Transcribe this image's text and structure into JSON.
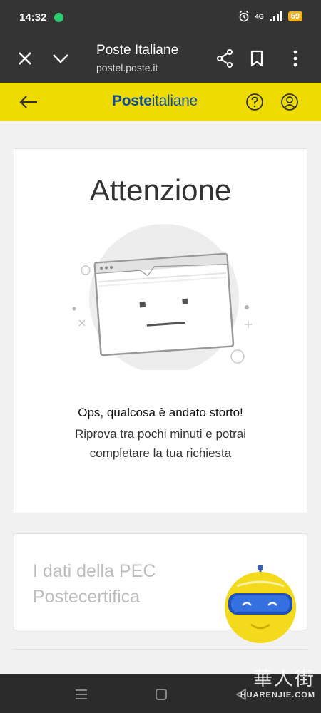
{
  "status_bar": {
    "time": "14:32",
    "network": "4G",
    "battery": "69"
  },
  "browser": {
    "title": "Poste Italiane",
    "url": "postel.poste.it",
    "icons": [
      "close-icon",
      "chevron-down-icon",
      "share-icon",
      "bookmark-icon",
      "more-vertical-icon"
    ]
  },
  "header": {
    "logo_bold": "Poste",
    "logo_light": "italiane",
    "icons": [
      "back-arrow-icon",
      "help-icon",
      "user-icon"
    ]
  },
  "error_card": {
    "title": "Attenzione",
    "message_bold": "Ops, qualcosa è andato storto!",
    "message_line1": "Riprova tra pochi minuti e potrai",
    "message_line2": "completare la tua richiesta"
  },
  "pec_card": {
    "title_line1": "I dati della PEC",
    "title_line2": "Postecertifica"
  },
  "watermark": {
    "top": "華人街",
    "bottom": "HUARENJIE.COM"
  },
  "colors": {
    "brand_yellow": "#eedc00",
    "brand_blue": "#104d99",
    "dark_bar": "#343434"
  }
}
